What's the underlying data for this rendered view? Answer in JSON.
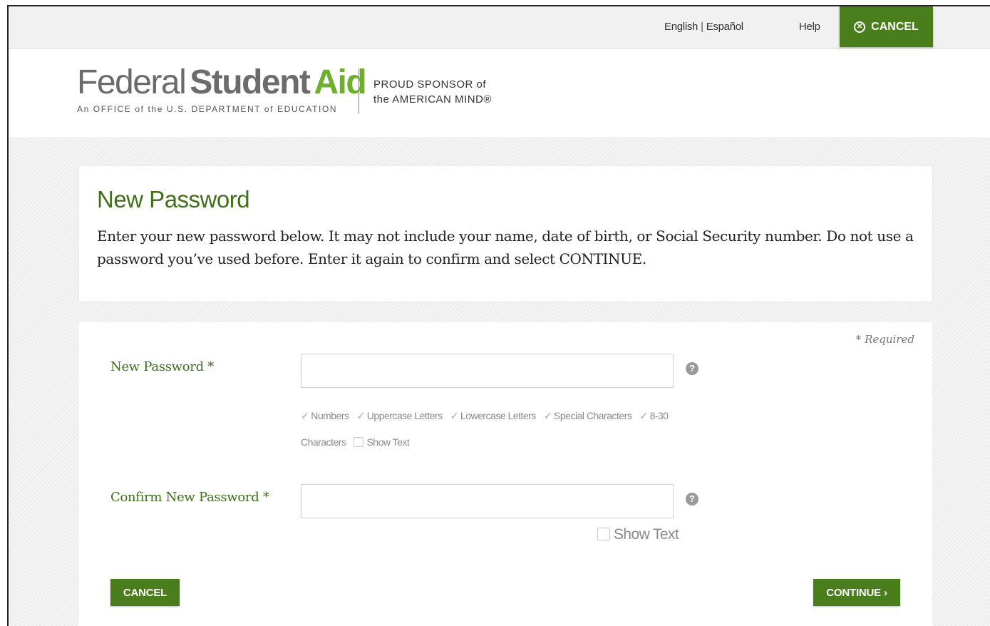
{
  "topbar": {
    "lang_english": "English",
    "lang_separator": "|",
    "lang_espanol": "Español",
    "help": "Help",
    "cancel_label": "CANCEL"
  },
  "header": {
    "logo_federal": "Federal",
    "logo_student": "Student",
    "logo_aid": "Aid",
    "logo_subtitle": "An OFFICE of the U.S. DEPARTMENT of EDUCATION",
    "sponsor_line1": "PROUD SPONSOR of",
    "sponsor_line2": "the AMERICAN MIND®"
  },
  "intro": {
    "title": "New Password",
    "text": "Enter your new password below. It may not include your name, date of birth, or Social Security number. Do not use a password you’ve used before. Enter it again to confirm and select CONTINUE."
  },
  "form": {
    "required_note": "* Required",
    "new_password_label": "New Password *",
    "new_password_value": "",
    "requirements": [
      "Numbers",
      "Uppercase Letters",
      "Lowercase Letters",
      "Special Characters",
      "8-30"
    ],
    "requirements_wrap": "Characters",
    "show_text_1": "Show Text",
    "confirm_password_label": "Confirm New Password *",
    "confirm_password_value": "",
    "show_text_2": "Show Text",
    "cancel_label": "CANCEL",
    "continue_label": "CONTINUE ›"
  },
  "colors": {
    "brand_green": "#4a7e1d",
    "title_green": "#3f6f1a",
    "logo_aid_green": "#6fae2e"
  },
  "icons": [
    "circle-x-icon",
    "question-circle-icon",
    "checkmark-icon"
  ]
}
